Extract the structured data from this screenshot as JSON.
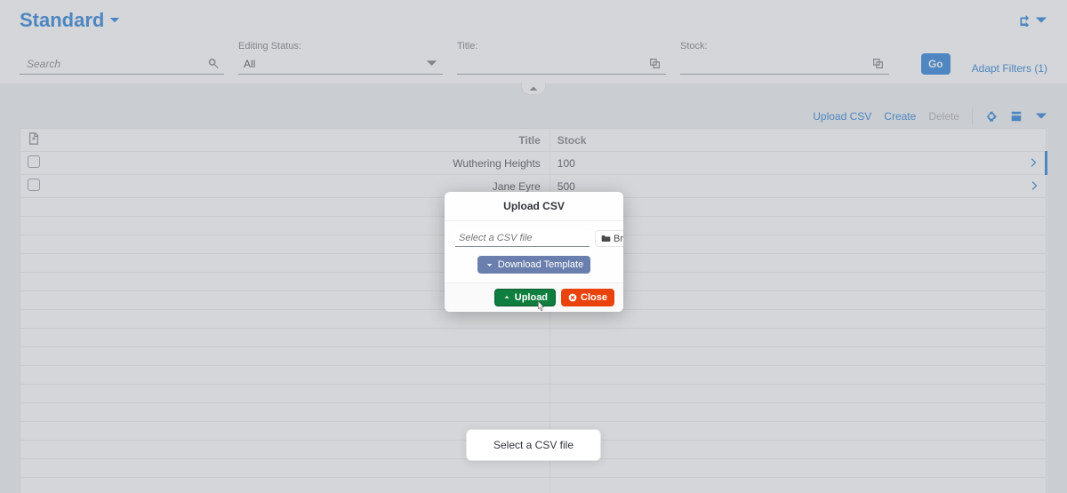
{
  "header": {
    "title": "Standard"
  },
  "filters": {
    "search_placeholder": "Search",
    "editing_status_label": "Editing Status:",
    "editing_status_value": "All",
    "title_label": "Title:",
    "stock_label": "Stock:",
    "go_label": "Go",
    "adapt_label": "Adapt Filters (1)"
  },
  "toolbar": {
    "upload_csv": "Upload CSV",
    "create": "Create",
    "delete": "Delete"
  },
  "table": {
    "columns": {
      "title": "Title",
      "stock": "Stock"
    },
    "rows": [
      {
        "title": "Wuthering Heights",
        "stock": "100"
      },
      {
        "title": "Jane Eyre",
        "stock": "500"
      }
    ]
  },
  "dialog": {
    "title": "Upload CSV",
    "file_placeholder": "Select a CSV file",
    "browse_label": "Browse..",
    "download_template_label": "Download Template",
    "upload_label": "Upload",
    "close_label": "Close"
  },
  "toast": {
    "message": "Select a CSV file"
  }
}
